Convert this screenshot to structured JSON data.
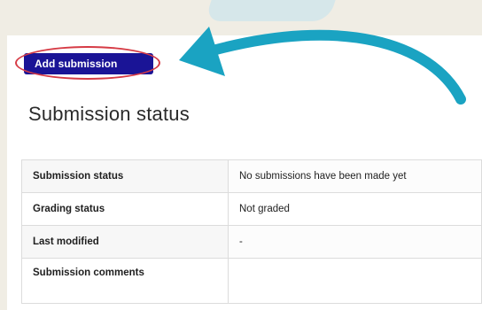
{
  "actions": {
    "add_submission_label": "Add submission"
  },
  "section": {
    "title": "Submission status"
  },
  "status_table": {
    "rows": [
      {
        "label": "Submission status",
        "value": "No submissions have been made yet"
      },
      {
        "label": "Grading status",
        "value": "Not graded"
      },
      {
        "label": "Last modified",
        "value": "-"
      },
      {
        "label": "Submission comments",
        "value": ""
      }
    ]
  },
  "annotations": {
    "highlight_color": "#d63b45",
    "arrow_color": "#1aa3c2",
    "arrow_icon": "curved-arrow-icon"
  },
  "colors": {
    "button_background": "#1a1496",
    "page_background": "#f0ede4",
    "panel_background": "#ffffff"
  }
}
